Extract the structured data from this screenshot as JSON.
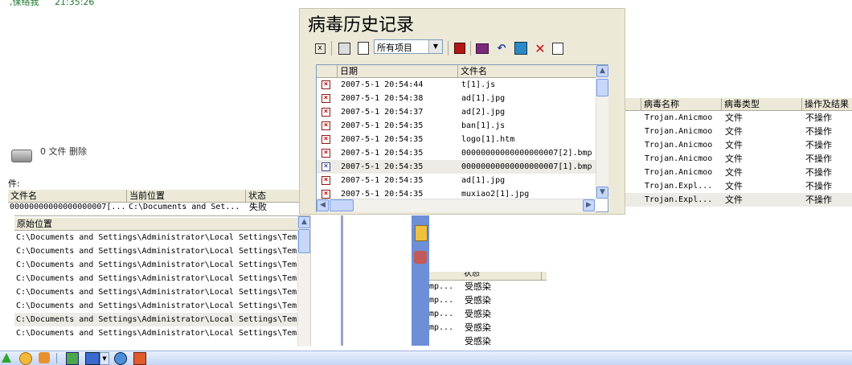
{
  "top_fragment": {
    "text": ",保络我",
    "time": "21:35:26"
  },
  "history_window": {
    "title": "病毒历史记录",
    "filter_select": "所有项目",
    "columns": {
      "date": "日期",
      "file": "文件名"
    },
    "rows": [
      {
        "date": "2007-5-1 20:54:44",
        "file": "t[1].js"
      },
      {
        "date": "2007-5-1 20:54:38",
        "file": "ad[1].jpg"
      },
      {
        "date": "2007-5-1 20:54:37",
        "file": "ad[2].jpg"
      },
      {
        "date": "2007-5-1 20:54:35",
        "file": "ban[1].js"
      },
      {
        "date": "2007-5-1 20:54:35",
        "file": "logo[1].htm"
      },
      {
        "date": "2007-5-1 20:54:35",
        "file": "00000000000000000007[2].bmp"
      },
      {
        "date": "2007-5-1 20:54:35",
        "file": "00000000000000000007[1].bmp",
        "selected": true
      },
      {
        "date": "2007-5-1 20:54:35",
        "file": "ad[1].jpg"
      },
      {
        "date": "2007-5-1 20:54:35",
        "file": "muxiao2[1].jpg"
      }
    ],
    "toolbar_icons": [
      "close-panel-icon",
      "properties-icon",
      "export-icon",
      "save-icon",
      "book-icon",
      "undo-icon",
      "scan-icon",
      "delete-icon",
      "restore-icon"
    ]
  },
  "virus_panel": {
    "columns": {
      "name": "病毒名称",
      "type": "病毒类型",
      "action": "操作及结果"
    },
    "rows": [
      {
        "name": "Trojan.Anicmoo",
        "type": "文件",
        "action": "不操作"
      },
      {
        "name": "Trojan.Anicmoo",
        "type": "文件",
        "action": "不操作"
      },
      {
        "name": "Trojan.Anicmoo",
        "type": "文件",
        "action": "不操作"
      },
      {
        "name": "Trojan.Anicmoo",
        "type": "文件",
        "action": "不操作"
      },
      {
        "name": "Trojan.Anicmoo",
        "type": "文件",
        "action": "不操作"
      },
      {
        "name": "Trojan.Expl...",
        "type": "文件",
        "action": "不操作"
      },
      {
        "name": "Trojan.Expl...",
        "type": "文件",
        "action": "不操作",
        "selected": true
      }
    ]
  },
  "delete_panel": {
    "summary": "0 文件 删除",
    "section_label": "件:",
    "columns": {
      "file": "文件名",
      "location": "当前位置",
      "status": "状态"
    },
    "row": {
      "file": "00000000000000000007[...",
      "location": "C:\\Documents and Set...",
      "status": "失败"
    }
  },
  "origin_panel": {
    "column": "原始位置",
    "rows": [
      "C:\\Documents and Settings\\Administrator\\Local Settings\\Tem",
      "C:\\Documents and Settings\\Administrator\\Local Settings\\Tem",
      "C:\\Documents and Settings\\Administrator\\Local Settings\\Tem",
      "C:\\Documents and Settings\\Administrator\\Local Settings\\Tem",
      "C:\\Documents and Settings\\Administrator\\Local Settings\\Tem",
      "C:\\Documents and Settings\\Administrator\\Local Settings\\Tem",
      "C:\\Documents and Settings\\Administrator\\Local Settings\\Tem",
      "C:\\Documents and Settings\\Administrator\\Local Settings\\Tem"
    ],
    "selected_index": 6
  },
  "status_panel": {
    "column": "状态",
    "rows": [
      {
        "prefix": "mp...",
        "status": "受感染"
      },
      {
        "prefix": "mp...",
        "status": "受感染"
      },
      {
        "prefix": "mp...",
        "status": "受感染"
      },
      {
        "prefix": "mp...",
        "status": "受感染"
      },
      {
        "prefix": "",
        "status": "受感染"
      }
    ]
  },
  "taskbar": {
    "icons": [
      "up-arrow-icon",
      "smiley-icon",
      "messenger-icon",
      "network-icon",
      "display-icon",
      "dropdown-icon",
      "globe-icon",
      "shield-icon"
    ]
  }
}
